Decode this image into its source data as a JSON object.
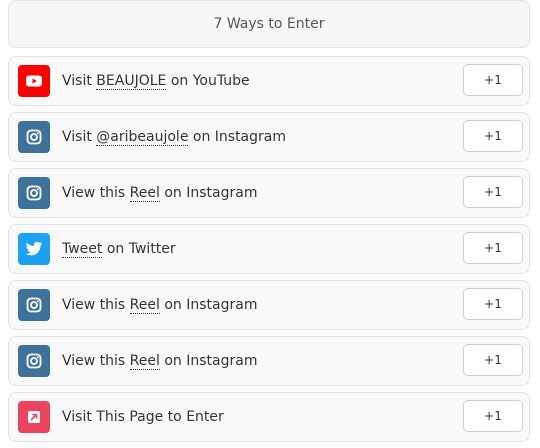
{
  "header": {
    "title": "7 Ways to Enter"
  },
  "entries": [
    {
      "icon": "youtube-icon",
      "color": "#ff0000",
      "pre": "Visit ",
      "link": "BEAUJOLE",
      "post": " on YouTube",
      "points": "+1"
    },
    {
      "icon": "instagram-icon",
      "color": "#3f729b",
      "pre": "Visit ",
      "link": "@aribeaujole",
      "post": " on Instagram",
      "points": "+1"
    },
    {
      "icon": "instagram-icon",
      "color": "#3f729b",
      "pre": "View this ",
      "link": "Reel",
      "post": " on Instagram",
      "points": "+1"
    },
    {
      "icon": "twitter-icon",
      "color": "#1da1f2",
      "pre": "",
      "link": "Tweet",
      "post": " on Twitter",
      "points": "+1"
    },
    {
      "icon": "instagram-icon",
      "color": "#3f729b",
      "pre": "View this ",
      "link": "Reel",
      "post": " on Instagram",
      "points": "+1"
    },
    {
      "icon": "instagram-icon",
      "color": "#3f729b",
      "pre": "View this ",
      "link": "Reel",
      "post": " on Instagram",
      "points": "+1"
    },
    {
      "icon": "external-link-icon",
      "color": "#e9455f",
      "pre": "Visit This Page to Enter",
      "link": "",
      "post": "",
      "points": "+1"
    }
  ]
}
